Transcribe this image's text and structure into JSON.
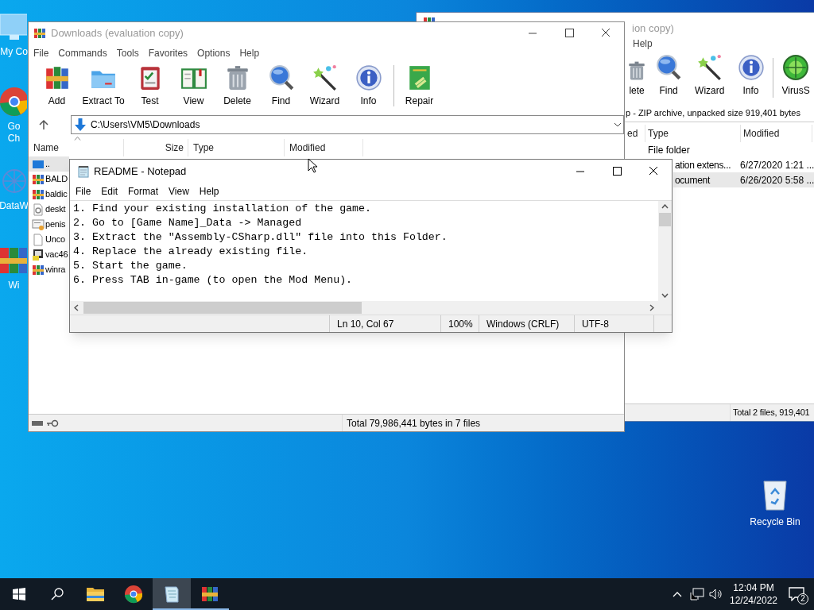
{
  "desktop_icons": [
    {
      "kind": "computer",
      "lines": [
        "My Co"
      ]
    },
    {
      "kind": "chrome",
      "lines": [
        "Go",
        "Ch"
      ]
    },
    {
      "kind": "data",
      "lines": [
        "DataW"
      ]
    },
    {
      "kind": "winrar",
      "lines": [
        "Wi"
      ]
    }
  ],
  "recycle_bin": {
    "label": "Recycle Bin"
  },
  "back_window": {
    "title": "ion copy)",
    "menu": [
      "Help"
    ],
    "toolbar": [
      {
        "kind": "delete",
        "label": "lete"
      },
      {
        "kind": "find",
        "label": "Find"
      },
      {
        "kind": "wizard",
        "label": "Wizard"
      },
      {
        "kind": "info",
        "label": "Info"
      },
      {
        "kind": "virus",
        "label": "VirusS"
      }
    ],
    "address": "p - ZIP archive, unpacked size 919,401 bytes",
    "columns": [
      "ed",
      "Type",
      "Modified"
    ],
    "rows": [
      {
        "type": "File folder",
        "selected": false
      },
      {
        "type": "ation extens...",
        "modified": "6/27/2020 1:21 ...",
        "selected": false
      },
      {
        "type": "ocument",
        "modified": "6/26/2020 5:58 ...",
        "selected": true
      }
    ],
    "status": "Total 2 files, 919,401"
  },
  "winrar_window": {
    "title": "Downloads (evaluation copy)",
    "menu": [
      "File",
      "Commands",
      "Tools",
      "Favorites",
      "Options",
      "Help"
    ],
    "toolbar": [
      {
        "kind": "add",
        "label": "Add"
      },
      {
        "kind": "extract",
        "label": "Extract To"
      },
      {
        "kind": "test",
        "label": "Test"
      },
      {
        "kind": "view",
        "label": "View"
      },
      {
        "kind": "delete",
        "label": "Delete"
      },
      {
        "kind": "find",
        "label": "Find"
      },
      {
        "kind": "wizard",
        "label": "Wizard"
      },
      {
        "kind": "info",
        "label": "Info"
      },
      {
        "kind": "separator"
      },
      {
        "kind": "repair",
        "label": "Repair"
      }
    ],
    "address": "C:\\Users\\VM5\\Downloads",
    "columns": [
      "Name",
      "Size",
      "Type",
      "Modified"
    ],
    "rows": [
      {
        "kind": "up",
        "name": "..",
        "selected": true
      },
      {
        "kind": "archive",
        "name": "BALD",
        "selected": false
      },
      {
        "kind": "archive",
        "name": "baldic",
        "selected": false
      },
      {
        "kind": "settings",
        "name": "deskt",
        "selected": false
      },
      {
        "kind": "certificate",
        "name": "penis",
        "selected": false
      },
      {
        "kind": "blank",
        "name": "Unco",
        "selected": false
      },
      {
        "kind": "program",
        "name": "vac46",
        "selected": false
      },
      {
        "kind": "archive",
        "name": "winra",
        "selected": false
      }
    ],
    "status": "Total 79,986,441 bytes in 7 files"
  },
  "notepad": {
    "title": "README - Notepad",
    "menu": [
      "File",
      "Edit",
      "Format",
      "View",
      "Help"
    ],
    "lines": [
      "1. Find your existing installation of the game.",
      "2. Go to [Game Name]_Data -> Managed",
      "3. Extract the \"Assembly-CSharp.dll\" file into this Folder.",
      "4. Replace the already existing file.",
      "5. Start the game.",
      "6. Press TAB in-game (to open the Mod Menu)."
    ],
    "status": [
      "Ln 10, Col 67",
      "100%",
      "Windows (CRLF)",
      "UTF-8"
    ]
  },
  "taskbar": {
    "apps": [
      {
        "kind": "explorer",
        "active": false,
        "running": false
      },
      {
        "kind": "chrome",
        "active": false,
        "running": false
      },
      {
        "kind": "notepad",
        "active": true,
        "running": true
      },
      {
        "kind": "winrar",
        "active": false,
        "running": true
      }
    ],
    "time": "12:04 PM",
    "date": "12/24/2022",
    "notifications": "2"
  }
}
